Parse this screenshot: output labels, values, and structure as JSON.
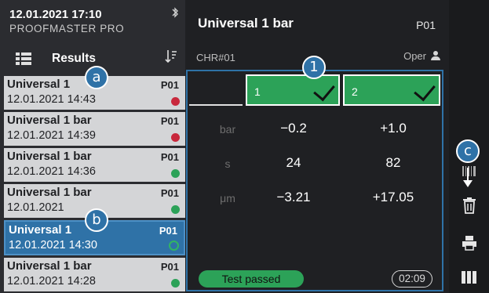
{
  "status": {
    "datetime": "12.01.2021 17:10",
    "device": "PROOFMASTER PRO"
  },
  "sidebar": {
    "results_label": "Results",
    "items": [
      {
        "name": "Universal 1",
        "program": "P01",
        "time": "12.01.2021 14:43",
        "status": "fail"
      },
      {
        "name": "Universal 1 bar",
        "program": "P01",
        "time": "12.01.2021 14:39",
        "status": "fail"
      },
      {
        "name": "Universal 1 bar",
        "program": "P01",
        "time": "12.01.2021 14:36",
        "status": "pass"
      },
      {
        "name": "Universal 1 bar",
        "program": "P01",
        "time": "12.01.2021",
        "status": "pass"
      },
      {
        "name": "Universal 1",
        "program": "P01",
        "time": "12.01.2021 14:30",
        "status": "pass"
      },
      {
        "name": "Universal 1 bar",
        "program": "P01",
        "time": "12.01.2021 14:28",
        "status": "pass"
      }
    ]
  },
  "main": {
    "title": "Universal 1 bar",
    "program": "P01",
    "channel": "CHR#01",
    "operator": "Oper",
    "tabs": [
      {
        "label": "1"
      },
      {
        "label": "2"
      }
    ],
    "rows": [
      {
        "unit": "bar",
        "v1": "−0.2",
        "v2": "+1.0"
      },
      {
        "unit": "s",
        "v1": "24",
        "v2": "82"
      },
      {
        "unit": "μm",
        "v1": "−3.21",
        "v2": "+17.05"
      }
    ],
    "result_badge": "Test passed",
    "duration": "02:09"
  },
  "callouts": {
    "one": "1",
    "a": "a",
    "b": "b",
    "c": "c"
  },
  "colors": {
    "accent": "#2f72a7",
    "pass": "#2ca258",
    "fail": "#c8283c"
  },
  "icons": [
    "bluetooth-icon",
    "list-icon",
    "sort-icon",
    "user-icon",
    "barcode-icon",
    "trash-icon",
    "printer-icon",
    "columns-icon"
  ]
}
